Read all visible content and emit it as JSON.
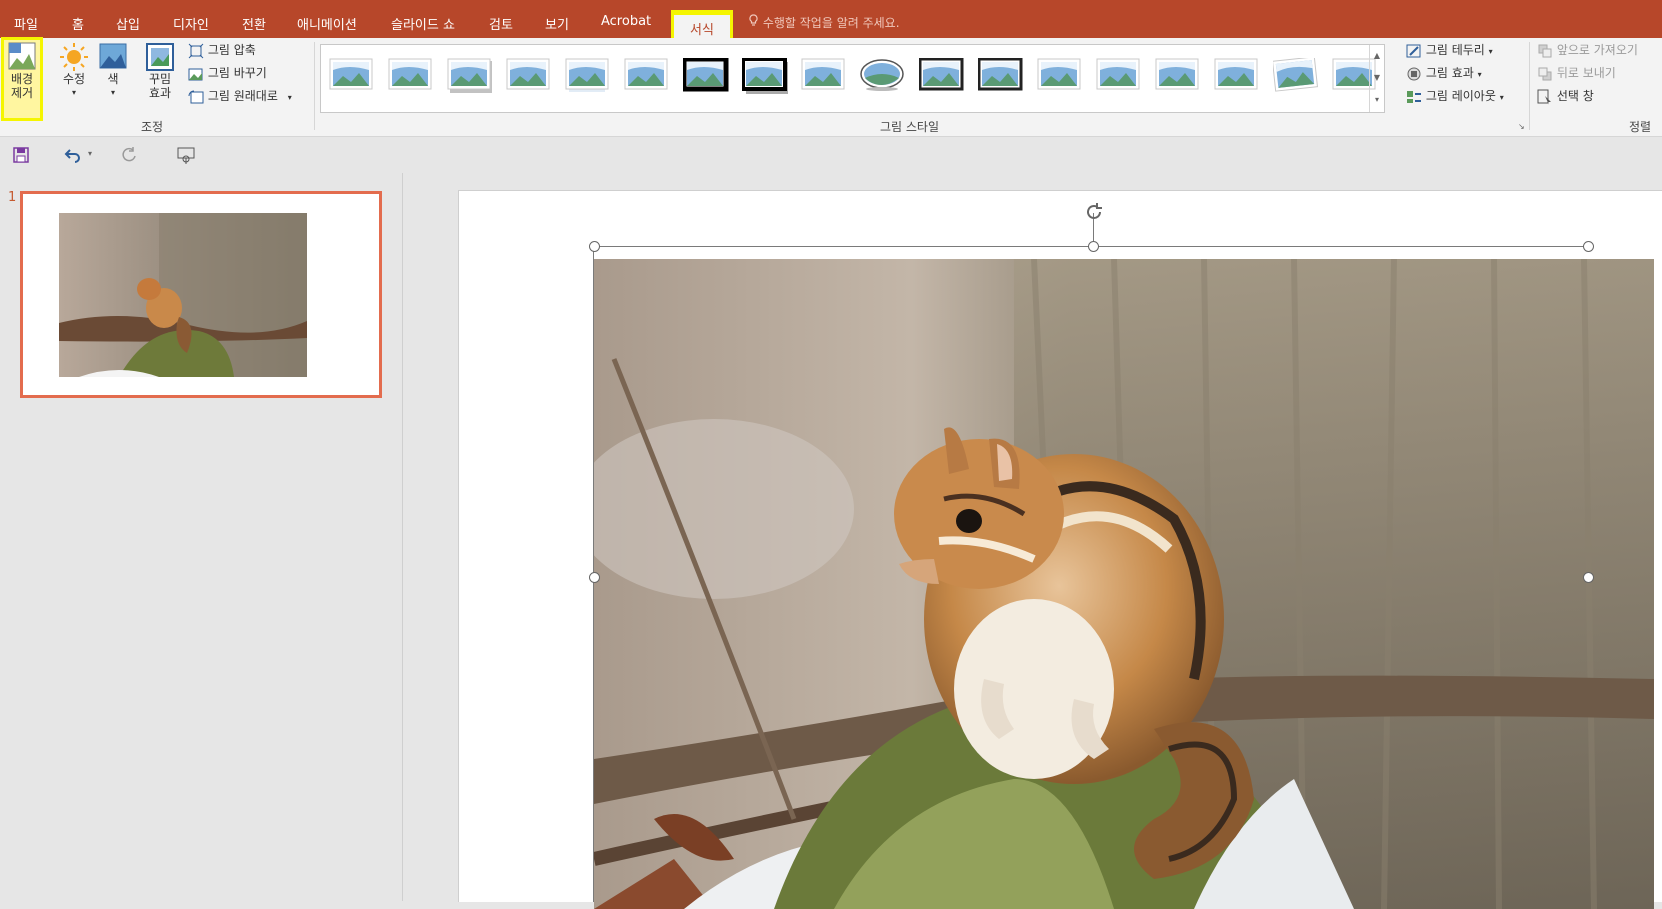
{
  "tabs": {
    "file": "파일",
    "home": "홈",
    "insert": "삽입",
    "design": "디자인",
    "transitions": "전환",
    "animations": "애니메이션",
    "slideshow": "슬라이드 쇼",
    "review": "검토",
    "view": "보기",
    "acrobat": "Acrobat",
    "format": "서식"
  },
  "tell_me": "수행할 작업을 알려 주세요.",
  "ribbon": {
    "remove_background": "배경\n제거",
    "corrections": "수정",
    "color": "색",
    "artistic_effects": "꾸밈\n효과",
    "compress_pictures": "그림 압축",
    "change_picture": "그림 바꾸기",
    "reset_picture": "그림 원래대로",
    "group_adjust": "조정",
    "group_picture_styles": "그림 스타일",
    "picture_border": "그림 테두리",
    "picture_effects": "그림 효과",
    "picture_layout": "그림 레이아웃",
    "bring_forward": "앞으로 가져오기",
    "send_backward": "뒤로 보내기",
    "selection_pane": "선택 창",
    "group_arrange": "정렬",
    "style_count": 18
  },
  "slides": {
    "current_number": "1"
  },
  "colors": {
    "accent": "#b7472a",
    "highlight": "#f5f500",
    "selection_border": "#e36c4e"
  }
}
